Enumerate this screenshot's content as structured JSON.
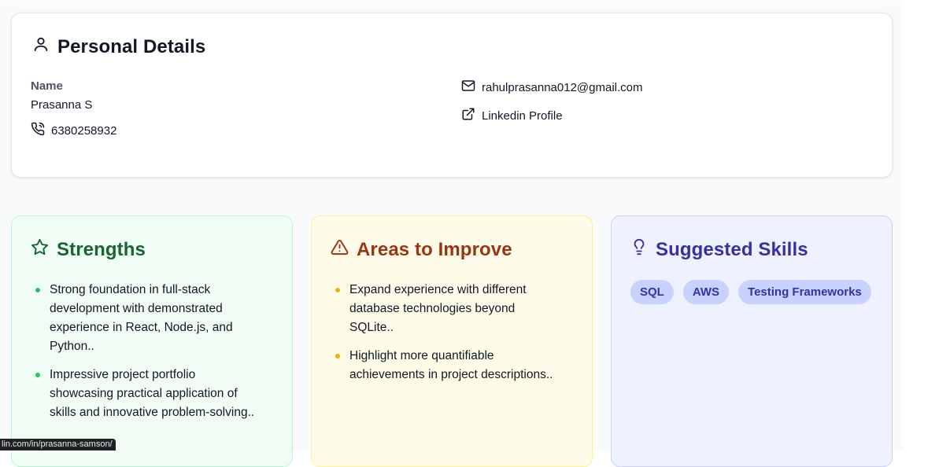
{
  "personal": {
    "title": "Personal Details",
    "name_label": "Name",
    "name_value": "Prasanna S",
    "phone": "6380258932",
    "email": "rahulprasanna012@gmail.com",
    "linkedin_label": "Linkedin Profile"
  },
  "strengths": {
    "title": "Strengths",
    "items": [
      "Strong foundation in full-stack development with demonstrated experience in React, Node.js, and Python..",
      "Impressive project portfolio showcasing practical application of skills and innovative problem-solving.."
    ]
  },
  "improve": {
    "title": "Areas to Improve",
    "items": [
      "Expand experience with different database technologies beyond SQLite..",
      "Highlight more quantifiable achievements in project descriptions.."
    ]
  },
  "skills": {
    "title": "Suggested Skills",
    "chips": [
      "SQL",
      "AWS",
      "Testing Frameworks"
    ]
  },
  "status_bar": {
    "url": "lin.com/in/prasanna-samson/"
  },
  "colors": {
    "strengths_accent": "#166534",
    "improve_accent": "#9a3412",
    "skills_accent": "#3730a3"
  },
  "icons": {
    "personal": "user-icon",
    "phone": "phone-icon",
    "email": "mail-icon",
    "linkedin": "external-link-icon",
    "strengths": "star-icon",
    "improve": "warning-triangle-icon",
    "skills": "lightbulb-icon"
  }
}
